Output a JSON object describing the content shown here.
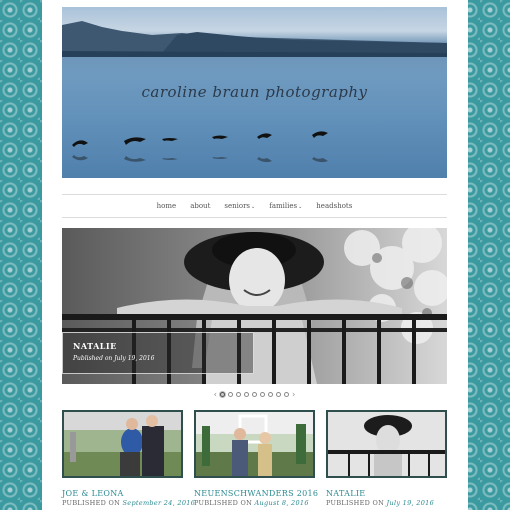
{
  "site": {
    "title": "caroline braun photography"
  },
  "nav": {
    "items": [
      {
        "label": "home",
        "has_dropdown": false
      },
      {
        "label": "about",
        "has_dropdown": false
      },
      {
        "label": "seniors",
        "has_dropdown": true
      },
      {
        "label": "families",
        "has_dropdown": true
      },
      {
        "label": "headshots",
        "has_dropdown": false
      }
    ],
    "dropdown_glyph": "⌄"
  },
  "slider": {
    "caption_title": "NATALIE",
    "caption_meta": "Published on July 19, 2016",
    "prev_glyph": "‹",
    "next_glyph": "›",
    "dot_count": 9,
    "active_index": 0
  },
  "posts": [
    {
      "title": "JOE & LEONA",
      "meta_prefix": "PUBLISHED ON",
      "date": "September 24, 2016"
    },
    {
      "title": "NEUENSCHWANDERS 2016",
      "meta_prefix": "PUBLISHED ON",
      "date": "August 8, 2016"
    },
    {
      "title": "NATALIE",
      "meta_prefix": "PUBLISHED ON",
      "date": "July 19, 2016"
    }
  ],
  "colors": {
    "accent": "#2b8a91",
    "background_pattern": "#3b9aa0"
  }
}
